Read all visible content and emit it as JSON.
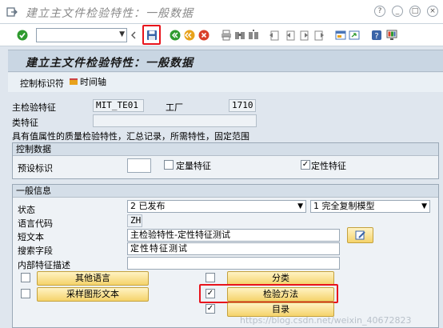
{
  "window": {
    "title": "建立主文件检验特性：一般数据",
    "icons": [
      "exit-icon",
      "minimize-icon",
      "restore-icon",
      "close-icon",
      "help-icon"
    ]
  },
  "toolbar": {
    "command_field_value": "",
    "icons": [
      "enter-icon",
      "dropdown-icon",
      "save-icon",
      "back-icon",
      "exit-icon",
      "cancel-icon",
      "print-icon",
      "find-icon",
      "find-next-icon",
      "first-page-icon",
      "prev-page-icon",
      "next-page-icon",
      "last-page-icon",
      "create-session-icon",
      "shortcut-icon",
      "help-icon",
      "layout-icon"
    ]
  },
  "screen": {
    "header": "建立主文件检验特性：一般数据",
    "app_buttons": {
      "control_indicator": "控制标识符",
      "timeline": "时间轴"
    }
  },
  "master": {
    "mic_label": "主检验特征",
    "mic_value": "MIT_TE01",
    "plant_label": "工厂",
    "plant_value": "1710",
    "class_label": "类特征",
    "class_value": "",
    "desc_line": "具有值属性的质量检验特性，汇总记录，所需特性，固定范围"
  },
  "control": {
    "group_title": "控制数据",
    "preset_label": "预设标识",
    "preset_value": "",
    "quant_label": "定量特征",
    "quant_checked": false,
    "qual_label": "定性特征",
    "qual_checked": true
  },
  "general": {
    "group_title": "一般信息",
    "status_label": "状态",
    "status_value": "2 已发布",
    "copy_model_value": "1 完全复制模型",
    "lang_label": "语言代码",
    "lang_value": "ZH",
    "short_text_label": "短文本",
    "short_text_value": "主检验特性-定性特征测试",
    "search_label": "搜索字段",
    "search_value": "定性特征测试",
    "internal_label": "内部特征描述",
    "internal_value": "",
    "buttons": {
      "other_lang": "其他语言",
      "sampling_text": "采样图形文本",
      "classification": "分类",
      "inspection_method": "检验方法",
      "catalog": "目录"
    },
    "checks": {
      "other_lang": false,
      "sampling_text": false,
      "classification": false,
      "inspection_method": true,
      "catalog": true
    }
  },
  "watermark": "https://blog.csdn.net/weixin_40672823"
}
